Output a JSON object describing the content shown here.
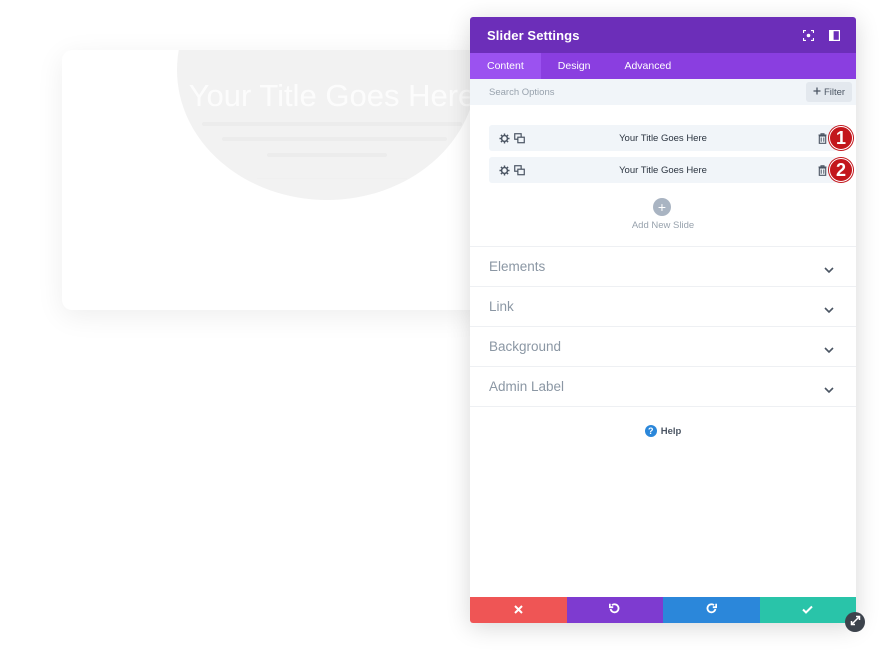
{
  "preview": {
    "title": "Your Title Goes Here"
  },
  "panel": {
    "title": "Slider Settings",
    "tabs": [
      {
        "label": "Content",
        "active": true
      },
      {
        "label": "Design",
        "active": false
      },
      {
        "label": "Advanced",
        "active": false
      }
    ],
    "search": {
      "placeholder": "Search Options",
      "value": ""
    },
    "filter_label": "Filter",
    "slides": [
      {
        "label": "Your Title Goes Here",
        "badge": "1"
      },
      {
        "label": "Your Title Goes Here",
        "badge": "2"
      }
    ],
    "add_slide_label": "Add New Slide",
    "sections": [
      "Elements",
      "Link",
      "Background",
      "Admin Label"
    ],
    "help_label": "Help"
  },
  "colors": {
    "header": "#6c2eb9",
    "tabs": "#8a3ee0",
    "cancel": "#ef5555",
    "undo": "#7e3bd0",
    "redo": "#2b87da",
    "save": "#29c4a9",
    "badge": "#c3161c"
  },
  "icons": {
    "header_left": "focus-icon",
    "header_right": "sidebar-toggle-icon",
    "slide_settings": "gear-icon",
    "slide_duplicate": "duplicate-icon",
    "slide_delete": "trash-icon",
    "section_toggle": "chevron-down-icon"
  }
}
